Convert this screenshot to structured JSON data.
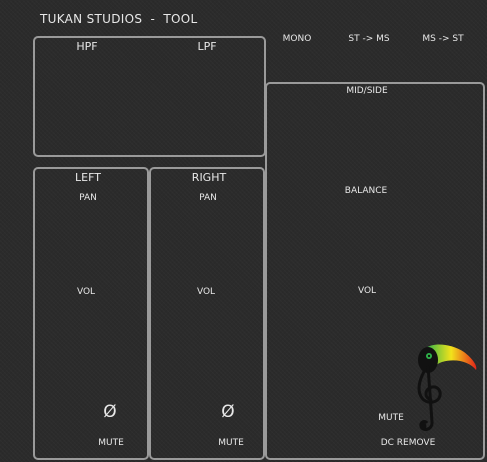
{
  "app": {
    "title": "TUKAN STUDIOS  -  TOOL"
  },
  "filters": {
    "hpf_label": "HPF",
    "lpf_label": "LPF"
  },
  "top_buttons": {
    "mono": "MONO",
    "st_to_ms": "ST -> MS",
    "ms_to_st": "MS -> ST"
  },
  "left": {
    "title": "LEFT",
    "pan": "PAN",
    "vol": "VOL",
    "phase": "Ø",
    "mute": "MUTE"
  },
  "right": {
    "title": "RIGHT",
    "pan": "PAN",
    "vol": "VOL",
    "phase": "Ø",
    "mute": "MUTE"
  },
  "mid_side": {
    "title": "MID/SIDE",
    "balance": "BALANCE",
    "vol": "VOL",
    "mute": "MUTE",
    "dc_remove": "DC REMOVE"
  },
  "icons": {
    "logo": "toucan-treble-clef-icon",
    "phase": "phase-invert-icon"
  },
  "colors": {
    "background": "#2b2b2b",
    "panel_border": "#9a9a9a",
    "text": "#e8e8e8"
  }
}
